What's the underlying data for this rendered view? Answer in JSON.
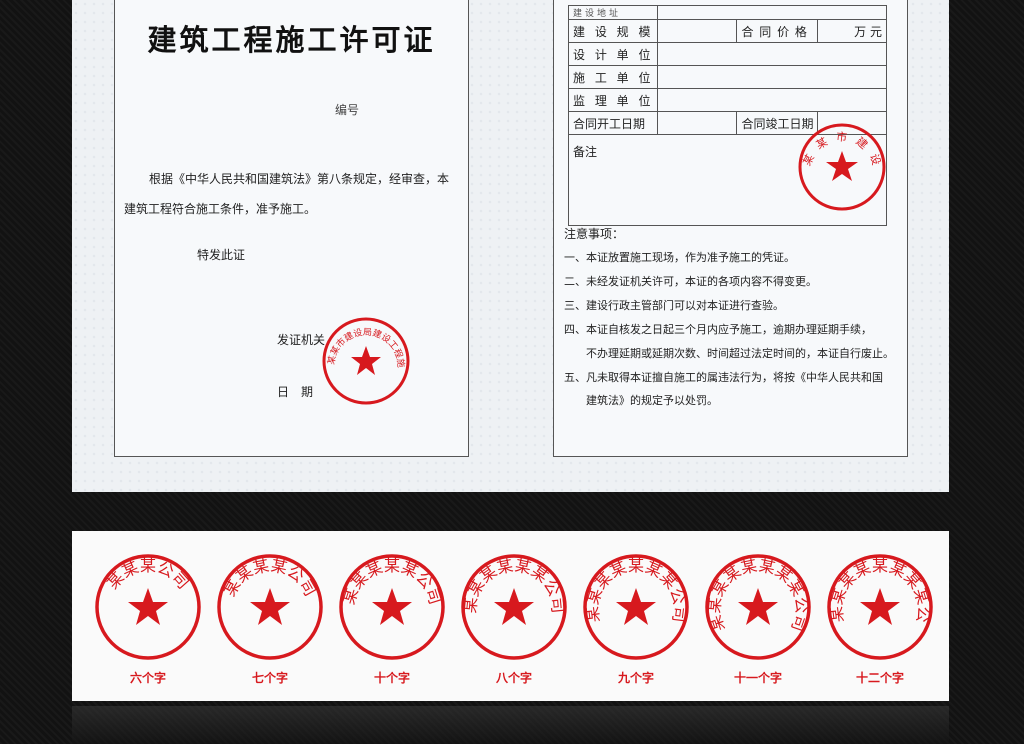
{
  "permit": {
    "title": "建筑工程施工许可证",
    "number_label": "编号",
    "body_line1": "根据《中华人民共和国建筑法》第八条规定，经审查，本",
    "body_line2": "建筑工程符合施工条件，准予施工。",
    "issue_text": "特发此证",
    "issuer_label": "发证机关",
    "date_label": "日　期",
    "issuer_seal_text": "某某市建设局建设工程施工许可证专用章"
  },
  "form": {
    "row0": "建设地址",
    "scale_label": "建 设 规 模",
    "price_label": "合 同 价 格",
    "price_unit": "万 元",
    "design_label": "设 计 单 位",
    "construct_label": "施 工 单 位",
    "supervise_label": "监 理 单 位",
    "start_label": "合同开工日期",
    "end_label": "合同竣工日期",
    "remarks_label": "备注",
    "remarks_seal_text": "某某市建设局"
  },
  "notice": {
    "title": "注意事项：",
    "items": [
      "一、本证放置施工现场，作为准予施工的凭证。",
      "二、未经发证机关许可，本证的各项内容不得变更。",
      "三、建设行政主管部门可以对本证进行查验。",
      "四、本证自核发之日起三个月内应予施工，逾期办理延期手续，",
      "　　不办理延期或延期次数、时间超过法定时间的，本证自行废止。",
      "五、凡未取得本证擅自施工的属违法行为，将按《中华人民共和国",
      "　　建筑法》的规定予以处罚。"
    ]
  },
  "seals": [
    {
      "caption": "六个字",
      "text": "某某某公司"
    },
    {
      "caption": "七个字",
      "text": "某某某某公司"
    },
    {
      "caption": "十个字",
      "text": "某某某某某公司"
    },
    {
      "caption": "八个字",
      "text": "某某某某某某公司"
    },
    {
      "caption": "九个字",
      "text": "某某某某某某某公司"
    },
    {
      "caption": "十一个字",
      "text": "某某某某某某某某公司"
    },
    {
      "caption": "十二个字",
      "text": "某某某某某某某某某公司"
    }
  ],
  "colors": {
    "seal_red": "#d7191e",
    "border": "#555555"
  }
}
